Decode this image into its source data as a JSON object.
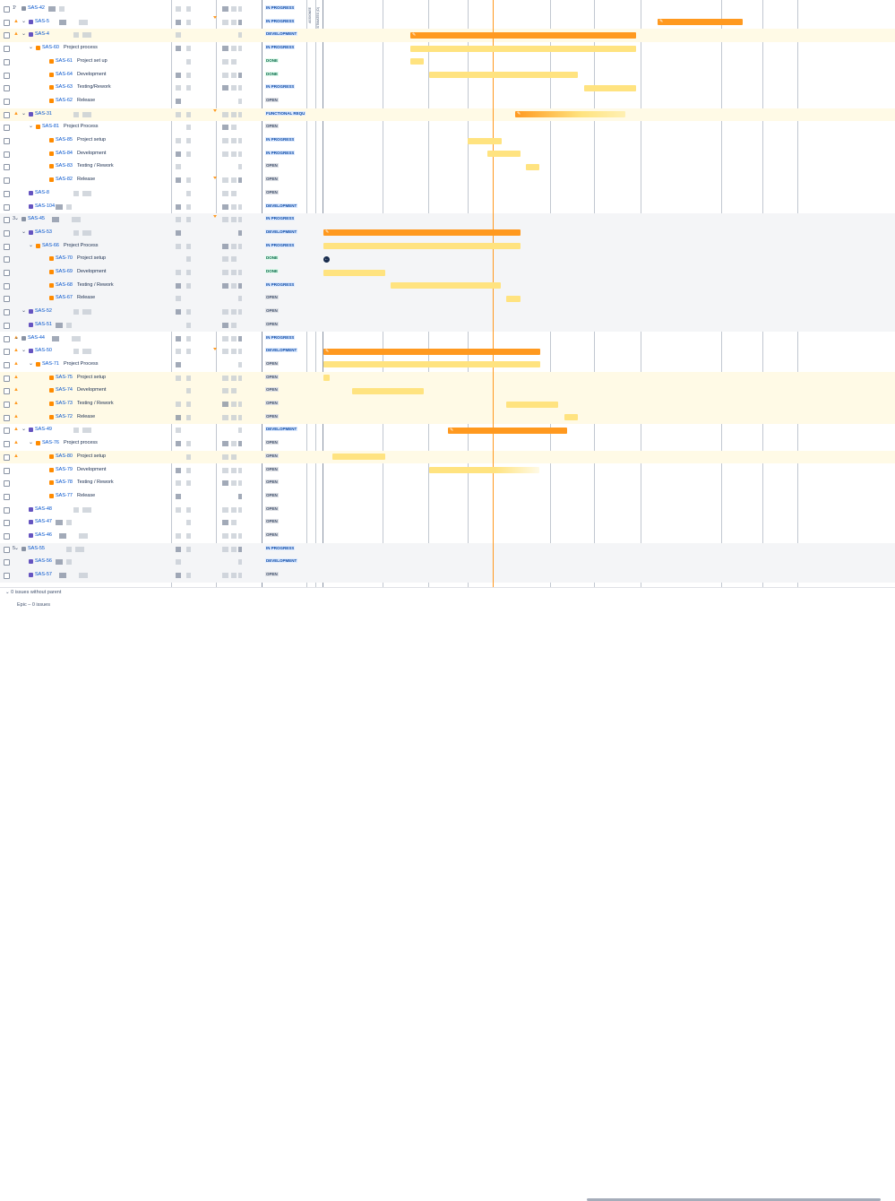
{
  "columns": {
    "assignee_header": "ASSIGNEE",
    "estimate_header": "ESTIMATES (D)"
  },
  "rows": [
    {
      "rank": "1",
      "key": "SAS-42",
      "summary": "",
      "status": "IN PROGRESS",
      "kind": "group"
    },
    {
      "rank": "",
      "key": "SAS-5",
      "summary": "",
      "status": "IN PROGRESS",
      "kind": "epic"
    },
    {
      "rank": "",
      "key": "SAS-4",
      "summary": "",
      "status": "DEVELOPMENT",
      "kind": "epic"
    },
    {
      "rank": "",
      "key": "SAS-60",
      "summary": "Project process",
      "status": "IN PROGRESS",
      "kind": "story"
    },
    {
      "rank": "",
      "key": "SAS-61",
      "summary": "Project set up",
      "status": "DONE",
      "kind": "story"
    },
    {
      "rank": "",
      "key": "SAS-64",
      "summary": "Development",
      "status": "DONE",
      "kind": "story"
    },
    {
      "rank": "",
      "key": "SAS-63",
      "summary": "Testing/Rework",
      "status": "IN PROGRESS",
      "kind": "story"
    },
    {
      "rank": "",
      "key": "SAS-62",
      "summary": "Release",
      "status": "OPEN",
      "kind": "story"
    },
    {
      "rank": "",
      "key": "SAS-31",
      "summary": "",
      "status": "FUNCTIONAL REQU",
      "kind": "epic"
    },
    {
      "rank": "",
      "key": "SAS-81",
      "summary": "Project Process",
      "status": "OPEN",
      "kind": "story"
    },
    {
      "rank": "",
      "key": "SAS-85",
      "summary": "Project setup",
      "status": "IN PROGRESS",
      "kind": "story"
    },
    {
      "rank": "",
      "key": "SAS-84",
      "summary": "Development",
      "status": "IN PROGRESS",
      "kind": "story"
    },
    {
      "rank": "",
      "key": "SAS-83",
      "summary": "Testing / Rework",
      "status": "OPEN",
      "kind": "story"
    },
    {
      "rank": "",
      "key": "SAS-82",
      "summary": "Release",
      "status": "OPEN",
      "kind": "story"
    },
    {
      "rank": "",
      "key": "SAS-8",
      "summary": "",
      "status": "OPEN",
      "kind": "epic"
    },
    {
      "rank": "",
      "key": "SAS-104",
      "summary": "",
      "status": "DEVELOPMENT",
      "kind": "epic"
    },
    {
      "rank": "3",
      "key": "SAS-45",
      "summary": "",
      "status": "IN PROGRESS",
      "kind": "group"
    },
    {
      "rank": "",
      "key": "SAS-53",
      "summary": "",
      "status": "DEVELOPMENT",
      "kind": "epic"
    },
    {
      "rank": "",
      "key": "SAS-66",
      "summary": "Project Process",
      "status": "IN PROGRESS",
      "kind": "story"
    },
    {
      "rank": "",
      "key": "SAS-70",
      "summary": "Project setup",
      "status": "DONE",
      "kind": "story"
    },
    {
      "rank": "",
      "key": "SAS-69",
      "summary": "Development",
      "status": "DONE",
      "kind": "story"
    },
    {
      "rank": "",
      "key": "SAS-68",
      "summary": "Testing / Rework",
      "status": "IN PROGRESS",
      "kind": "story"
    },
    {
      "rank": "",
      "key": "SAS-67",
      "summary": "Release",
      "status": "OPEN",
      "kind": "story"
    },
    {
      "rank": "",
      "key": "SAS-52",
      "summary": "",
      "status": "OPEN",
      "kind": "epic"
    },
    {
      "rank": "",
      "key": "SAS-51",
      "summary": "",
      "status": "OPEN",
      "kind": "epic"
    },
    {
      "rank": "",
      "key": "SAS-44",
      "summary": "",
      "status": "IN PROGRESS",
      "kind": "group"
    },
    {
      "rank": "",
      "key": "SAS-50",
      "summary": "",
      "status": "DEVELOPMENT",
      "kind": "epic"
    },
    {
      "rank": "",
      "key": "SAS-71",
      "summary": "Project Process",
      "status": "OPEN",
      "kind": "story"
    },
    {
      "rank": "",
      "key": "SAS-75",
      "summary": "Project setup",
      "status": "OPEN",
      "kind": "story"
    },
    {
      "rank": "",
      "key": "SAS-74",
      "summary": "Development",
      "status": "OPEN",
      "kind": "story"
    },
    {
      "rank": "",
      "key": "SAS-73",
      "summary": "Testing / Rework",
      "status": "OPEN",
      "kind": "story"
    },
    {
      "rank": "",
      "key": "SAS-72",
      "summary": "Release",
      "status": "OPEN",
      "kind": "story"
    },
    {
      "rank": "",
      "key": "SAS-49",
      "summary": "",
      "status": "DEVELOPMENT",
      "kind": "epic"
    },
    {
      "rank": "",
      "key": "SAS-76",
      "summary": "Project process",
      "status": "OPEN",
      "kind": "story"
    },
    {
      "rank": "",
      "key": "SAS-80",
      "summary": "Project setup",
      "status": "OPEN",
      "kind": "story"
    },
    {
      "rank": "",
      "key": "SAS-79",
      "summary": "Development",
      "status": "OPEN",
      "kind": "story"
    },
    {
      "rank": "",
      "key": "SAS-78",
      "summary": "Testing / Rework",
      "status": "OPEN",
      "kind": "story"
    },
    {
      "rank": "",
      "key": "SAS-77",
      "summary": "Release",
      "status": "OPEN",
      "kind": "story"
    },
    {
      "rank": "",
      "key": "SAS-48",
      "summary": "",
      "status": "OPEN",
      "kind": "epic"
    },
    {
      "rank": "",
      "key": "SAS-47",
      "summary": "",
      "status": "OPEN",
      "kind": "epic"
    },
    {
      "rank": "",
      "key": "SAS-46",
      "summary": "",
      "status": "OPEN",
      "kind": "epic"
    },
    {
      "rank": "5",
      "key": "SAS-55",
      "summary": "",
      "status": "IN PROGRESS",
      "kind": "group"
    },
    {
      "rank": "",
      "key": "SAS-56",
      "summary": "",
      "status": "DEVELOPMENT",
      "kind": "epic"
    },
    {
      "rank": "",
      "key": "SAS-57",
      "summary": "",
      "status": "OPEN",
      "kind": "epic"
    }
  ],
  "footer": {
    "no_parent": "0 issues without parent",
    "epic_count": "Epic – 0 issues"
  },
  "colors": {
    "bar_main": "#ff991f",
    "bar_light": "#ffe380",
    "today_line": "#ff991f",
    "link": "#0052cc"
  }
}
